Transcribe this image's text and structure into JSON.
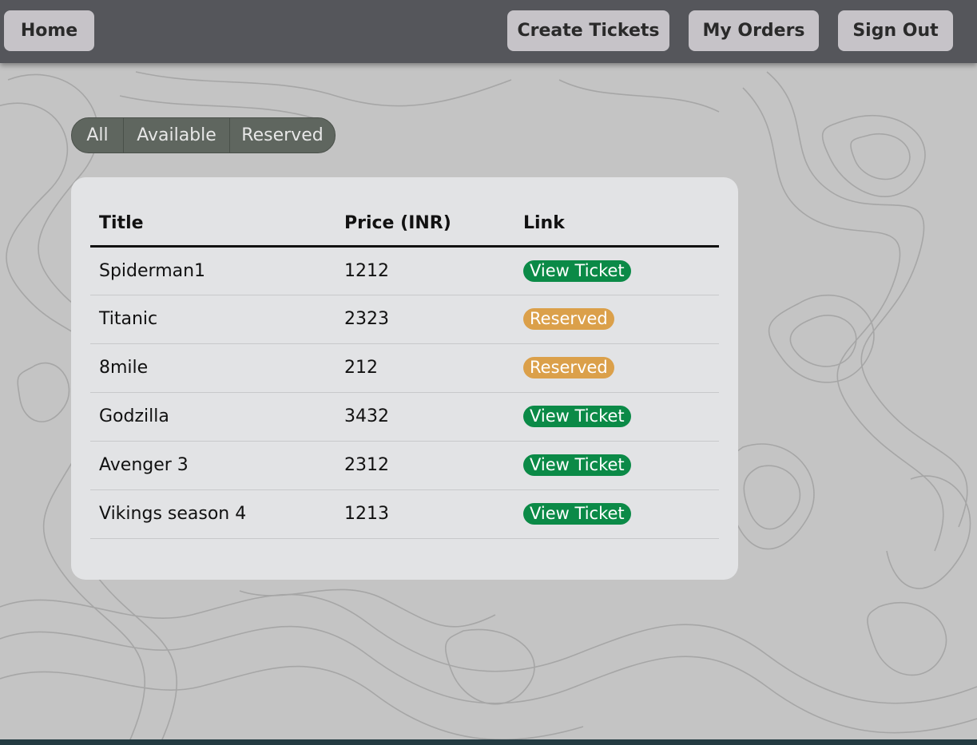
{
  "colors": {
    "navbar": "#55565b",
    "nav_button": "#c6c3c8",
    "filter_group": "#5f665f",
    "card": "#e2e3e5",
    "available_badge": "#0b8a47",
    "reserved_badge": "#dba04a",
    "footer": "#243b42"
  },
  "nav": {
    "home": "Home",
    "create": "Create Tickets",
    "orders": "My Orders",
    "signout": "Sign Out"
  },
  "filters": {
    "all": "All",
    "available": "Available",
    "reserved": "Reserved"
  },
  "table": {
    "headers": {
      "title": "Title",
      "price": "Price (INR)",
      "link": "Link"
    },
    "rows": [
      {
        "title": "Spiderman1",
        "price": "1212",
        "link": "View Ticket",
        "status": "available"
      },
      {
        "title": "Titanic",
        "price": "2323",
        "link": "Reserved",
        "status": "reserved"
      },
      {
        "title": "8mile",
        "price": "212",
        "link": "Reserved",
        "status": "reserved"
      },
      {
        "title": "Godzilla",
        "price": "3432",
        "link": "View Ticket",
        "status": "available"
      },
      {
        "title": "Avenger 3",
        "price": "2312",
        "link": "View Ticket",
        "status": "available"
      },
      {
        "title": "Vikings season 4",
        "price": "1213",
        "link": "View Ticket",
        "status": "available"
      }
    ]
  }
}
